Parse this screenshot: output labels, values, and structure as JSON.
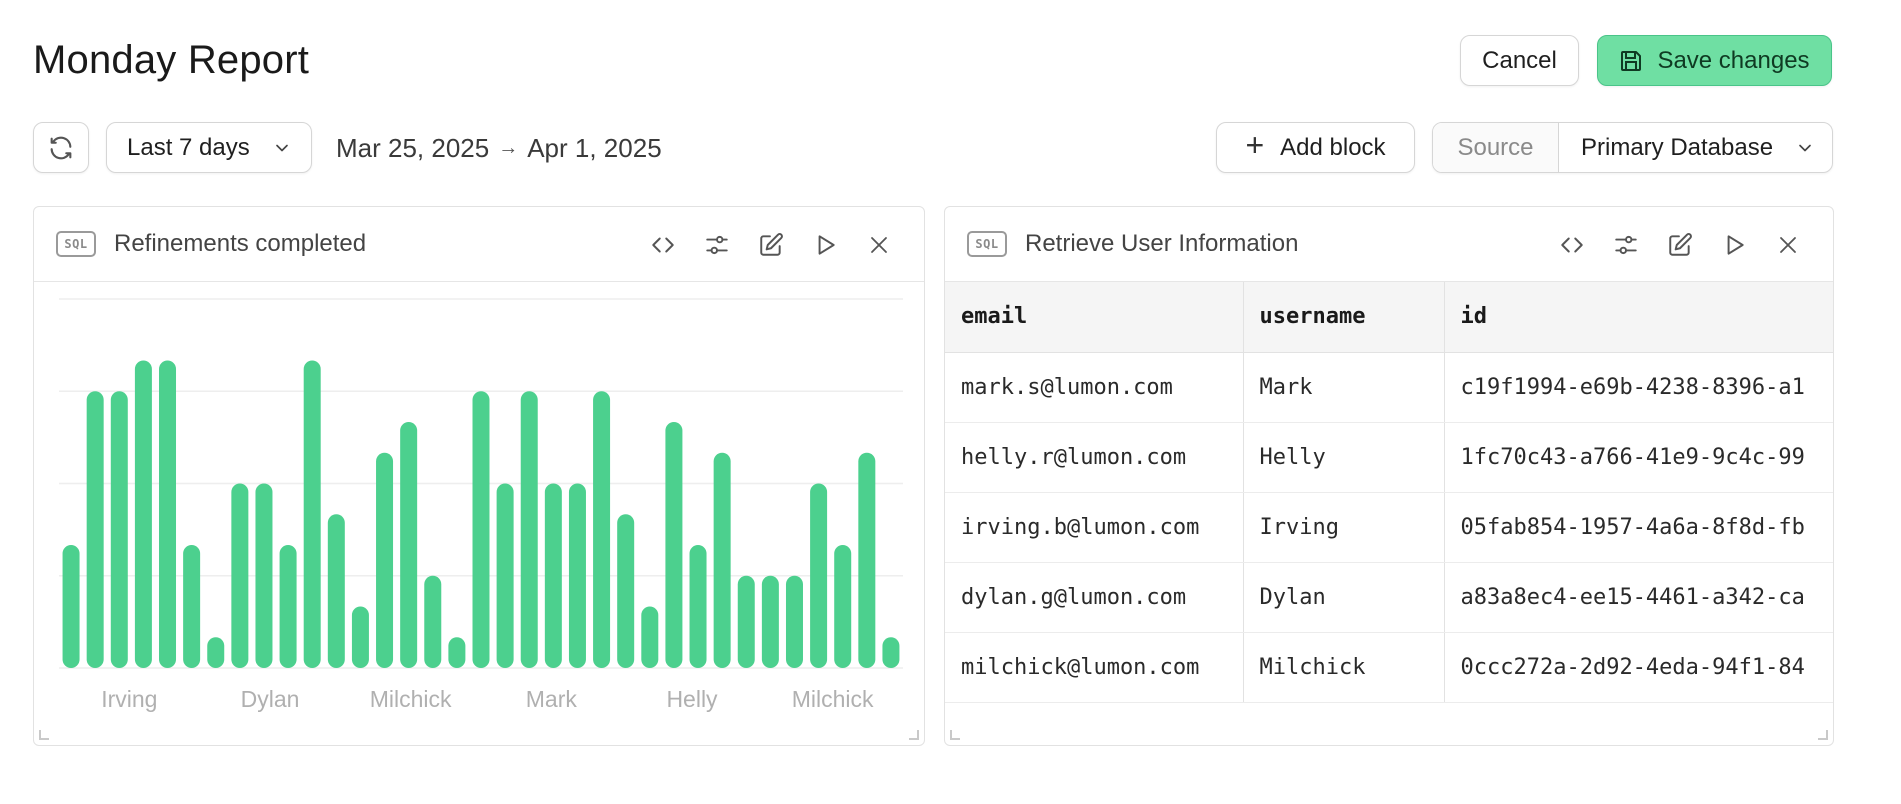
{
  "page": {
    "title": "Monday Report"
  },
  "header": {
    "cancel_label": "Cancel",
    "save_label": "Save changes",
    "save_icon": "floppy-disk-icon"
  },
  "toolbar": {
    "refresh_icon": "refresh-icon",
    "range_label": "Last 7 days",
    "date_start": "Mar 25, 2025",
    "date_arrow": "→",
    "date_end": "Apr 1, 2025",
    "add_block_label": "Add block",
    "source_label": "Source",
    "source_value": "Primary Database"
  },
  "colors": {
    "accent_green": "#4cd08e",
    "save_bg": "#6fdfa3"
  },
  "panels": {
    "left": {
      "badge": "SQL",
      "title": "Refinements completed"
    },
    "right": {
      "badge": "SQL",
      "title": "Retrieve User Information"
    },
    "action_icons": [
      "code-icon",
      "sliders-icon",
      "edit-icon",
      "play-icon",
      "close-icon"
    ]
  },
  "chart_data": {
    "type": "bar",
    "title": "",
    "xlabel": "",
    "ylabel": "",
    "grid": true,
    "ylim": [
      0,
      12
    ],
    "x_tick_labels": [
      "Irving",
      "Dylan",
      "Milchick",
      "Mark",
      "Helly",
      "Milchick"
    ],
    "values": [
      4,
      9,
      9,
      10,
      10,
      4,
      1,
      6,
      6,
      4,
      10,
      5,
      2,
      7,
      8,
      3,
      1,
      9,
      6,
      9,
      6,
      6,
      9,
      5,
      2,
      8,
      4,
      7,
      3,
      3,
      3,
      6,
      4,
      7,
      1
    ],
    "color": "#4cd08e"
  },
  "table": {
    "columns": [
      "email",
      "username",
      "id"
    ],
    "rows": [
      [
        "mark.s@lumon.com",
        "Mark",
        "c19f1994-e69b-4238-8396-a1"
      ],
      [
        "helly.r@lumon.com",
        "Helly",
        "1fc70c43-a766-41e9-9c4c-99"
      ],
      [
        "irving.b@lumon.com",
        "Irving",
        "05fab854-1957-4a6a-8f8d-fb"
      ],
      [
        "dylan.g@lumon.com",
        "Dylan",
        "a83a8ec4-ee15-4461-a342-ca"
      ],
      [
        "milchick@lumon.com",
        "Milchick",
        "0ccc272a-2d92-4eda-94f1-84"
      ]
    ]
  }
}
